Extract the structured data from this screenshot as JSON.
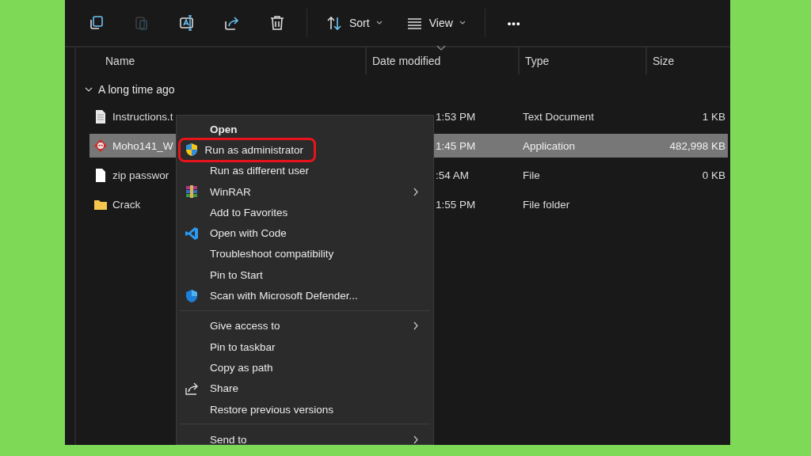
{
  "toolbar": {
    "icon_buttons": [
      {
        "disabled": false
      },
      {
        "disabled": true
      },
      {
        "disabled": false
      },
      {
        "disabled": false
      },
      {
        "disabled": false
      }
    ],
    "menus": [
      {
        "label": "Sort"
      },
      {
        "label": "View"
      }
    ],
    "more": "•••"
  },
  "table": {
    "columns": [
      "Name",
      "Date modified",
      "Type",
      "Size"
    ],
    "group": {
      "label": "A long time ago",
      "expanded": true
    },
    "rows": [
      {
        "kind": "text",
        "name": "Instructions.t",
        "date": "1:53 PM",
        "type": "Text Document",
        "size": "1 KB",
        "selected": false
      },
      {
        "kind": "app",
        "name": "Moho141_W",
        "date": "1:45 PM",
        "type": "Application",
        "size": "482,998 KB",
        "selected": true
      },
      {
        "kind": "file",
        "name": "zip passwor",
        "date": ":54 AM",
        "type": "File",
        "size": "0 KB",
        "selected": false
      },
      {
        "kind": "folder",
        "name": "Crack",
        "date": "1:55 PM",
        "type": "File folder",
        "selected": false
      }
    ]
  },
  "context_menu": {
    "items": [
      {
        "kind": "item",
        "label": "Open",
        "default": true,
        "submenu": false,
        "outlined": false
      },
      {
        "kind": "item",
        "label": "Run as administrator",
        "default": false,
        "submenu": false,
        "outlined": true
      },
      {
        "kind": "item",
        "label": "Run as different user",
        "default": false,
        "submenu": false,
        "outlined": false
      },
      {
        "kind": "item",
        "label": "WinRAR",
        "default": false,
        "submenu": true,
        "outlined": false
      },
      {
        "kind": "item",
        "label": "Add to Favorites",
        "default": false,
        "submenu": false,
        "outlined": false
      },
      {
        "kind": "item",
        "label": "Open with Code",
        "default": false,
        "submenu": false,
        "outlined": false
      },
      {
        "kind": "item",
        "label": "Troubleshoot compatibility",
        "default": false,
        "submenu": false,
        "outlined": false
      },
      {
        "kind": "item",
        "label": "Pin to Start",
        "default": false,
        "submenu": false,
        "outlined": false
      },
      {
        "kind": "item",
        "label": "Scan with Microsoft Defender...",
        "default": false,
        "submenu": false,
        "outlined": false
      },
      {
        "kind": "separator"
      },
      {
        "kind": "item",
        "label": "Give access to",
        "default": false,
        "submenu": true,
        "outlined": false
      },
      {
        "kind": "item",
        "label": "Pin to taskbar",
        "default": false,
        "submenu": false,
        "outlined": false
      },
      {
        "kind": "item",
        "label": "Copy as path",
        "default": false,
        "submenu": false,
        "outlined": false
      },
      {
        "kind": "item",
        "label": "Share",
        "default": false,
        "submenu": false,
        "outlined": false
      },
      {
        "kind": "item",
        "label": "Restore previous versions",
        "default": false,
        "submenu": false,
        "outlined": false
      },
      {
        "kind": "separator"
      },
      {
        "kind": "item",
        "label": "Send to",
        "default": false,
        "submenu": true,
        "outlined": false
      }
    ]
  }
}
